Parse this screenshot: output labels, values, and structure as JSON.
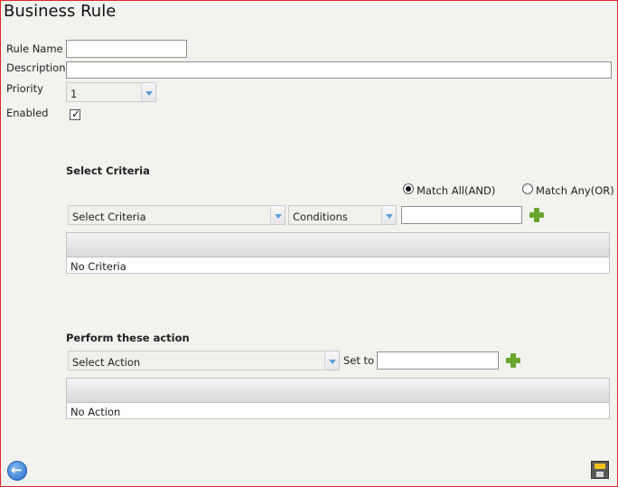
{
  "page": {
    "title": "Business Rule"
  },
  "form": {
    "rule_name_label": "Rule Name",
    "rule_name_value": "",
    "description_label": "Description",
    "description_value": "",
    "priority_label": "Priority",
    "priority_value": "1",
    "enabled_label": "Enabled",
    "enabled_checked": true
  },
  "criteria": {
    "heading": "Select Criteria",
    "match_all_label": "Match All(AND)",
    "match_any_label": "Match Any(OR)",
    "selected_match": "all",
    "criteria_select_value": "Select Criteria",
    "conditions_select_value": "Conditions",
    "condition_value": "",
    "empty_text": "No Criteria"
  },
  "actions": {
    "heading": "Perform these action",
    "action_select_value": "Select Action",
    "set_to_label": "Set to",
    "set_to_value": "",
    "empty_text": "No Action"
  },
  "icons": {
    "add": "plus-icon",
    "back": "back-arrow-icon",
    "save": "save-icon"
  },
  "colors": {
    "frame_border": "#e0262a",
    "background": "#f2f3ef",
    "add_green": "#6aa52f",
    "back_blue": "#2a6fc9",
    "arrow_blue": "#5b9fd8"
  }
}
